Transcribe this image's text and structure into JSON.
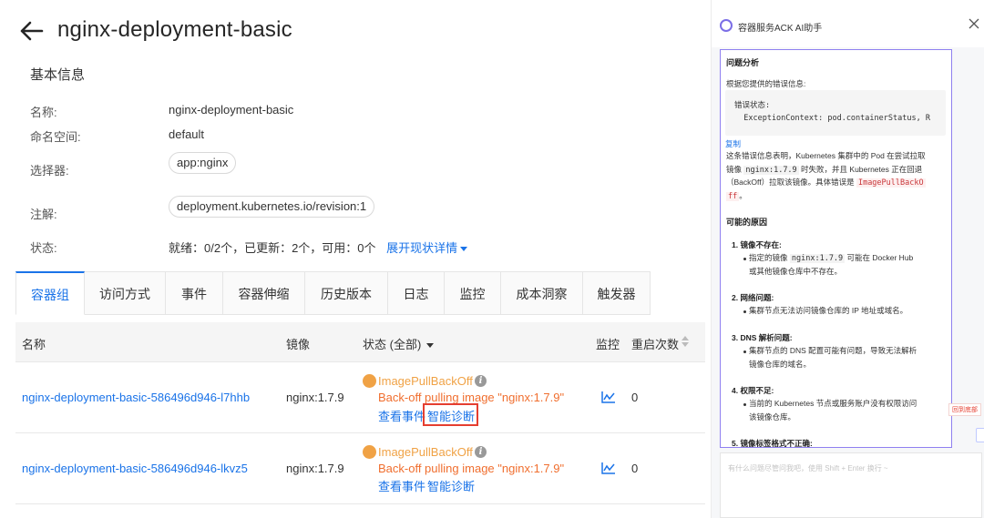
{
  "page": {
    "title": "nginx-deployment-basic",
    "section_title": "基本信息"
  },
  "info": {
    "name_label": "名称:",
    "name_value": "nginx-deployment-basic",
    "namespace_label": "命名空间:",
    "namespace_value": "default",
    "selector_label": "选择器:",
    "selector_value": "app:nginx",
    "annotation_label": "注解:",
    "annotation_value": "deployment.kubernetes.io/revision:1",
    "status_label": "状态:",
    "status_value": "就绪：0/2个，已更新：2个，可用：0个",
    "status_link": "展开现状详情"
  },
  "tabs": [
    {
      "label": "容器组",
      "active": true
    },
    {
      "label": "访问方式"
    },
    {
      "label": "事件"
    },
    {
      "label": "容器伸缩"
    },
    {
      "label": "历史版本"
    },
    {
      "label": "日志"
    },
    {
      "label": "监控"
    },
    {
      "label": "成本洞察"
    },
    {
      "label": "触发器"
    }
  ],
  "table": {
    "headers": {
      "name": "名称",
      "image": "镜像",
      "status": "状态 (全部)",
      "monitor": "监控",
      "restarts": "重启次数"
    },
    "rows": [
      {
        "name": "nginx-deployment-basic-586496d946-l7hhb",
        "image": "nginx:1.7.9",
        "status": "ImagePullBackOff",
        "error": "Back-off pulling image \"nginx:1.7.9\"",
        "action_events": "查看事件",
        "action_diagnose": "智能诊断",
        "restarts": "0"
      },
      {
        "name": "nginx-deployment-basic-586496d946-lkvz5",
        "image": "nginx:1.7.9",
        "status": "ImagePullBackOff",
        "error": "Back-off pulling image \"nginx:1.7.9\"",
        "action_events": "查看事件",
        "action_diagnose": "智能诊断",
        "restarts": "0"
      }
    ]
  },
  "assistant": {
    "title": "容器服务ACK AI助手",
    "analysis_heading": "问题分析",
    "intro": "根据您提供的错误信息:",
    "code_line1": "错误状态:",
    "code_line2": "  ExceptionContext: pod.containerStatus, R",
    "copy": "复制",
    "explain_a": "这条错误信息表明，Kubernetes 集群中的 Pod 在尝试拉取",
    "explain_b1": "镜像 ",
    "explain_b_code": "nginx:1.7.9",
    "explain_b2": " 时失败，并且 Kubernetes 正在回退",
    "explain_c1": "（BackOff）拉取该镜像。具体错误是 ",
    "explain_c_code": "ImagePullBackO",
    "explain_d_code": "ff",
    "explain_d2": "。",
    "causes_heading": "可能的原因",
    "cause1_title": "1. 镜像不存在:",
    "cause1_a1": "指定的镜像 ",
    "cause1_a_code": "nginx:1.7.9",
    "cause1_a2": " 可能在 Docker Hub",
    "cause1_b": "或其他镜像仓库中不存在。",
    "cause2_title": "2. 网络问题:",
    "cause2_a": "集群节点无法访问镜像仓库的 IP 地址或域名。",
    "cause3_title": "3. DNS 解析问题:",
    "cause3_a": "集群节点的 DNS 配置可能有问题，导致无法解析",
    "cause3_b": "镜像仓库的域名。",
    "cause4_title": "4. 权限不足:",
    "cause4_a": "当前的 Kubernetes 节点或服务账户没有权限访问",
    "cause4_b": "该镜像仓库。",
    "cause5_title": "5. 镜像标签格式不正确:",
    "scroll_bottom": "回到底部",
    "input_placeholder": "有什么问题尽管问我吧，使用 Shift + Enter 换行 ~"
  }
}
